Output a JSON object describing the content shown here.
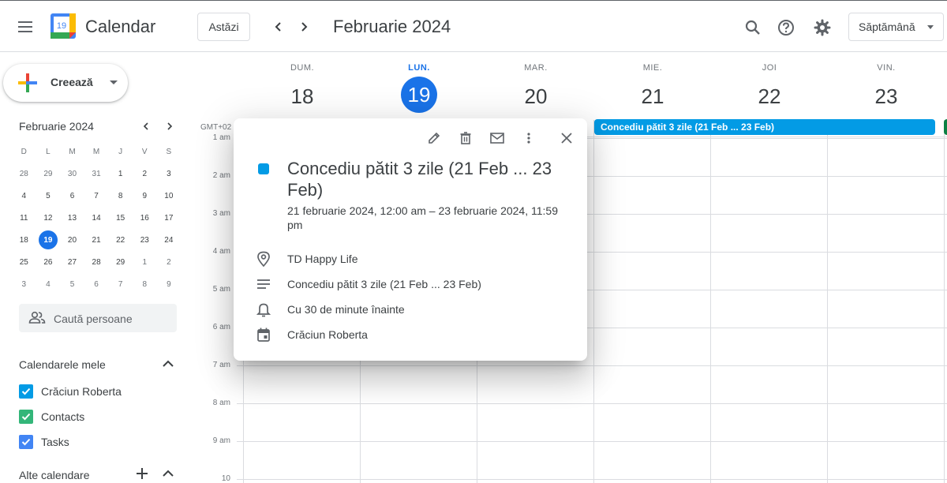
{
  "app": {
    "name": "Calendar",
    "logo_day": "19"
  },
  "header": {
    "today_label": "Astăzi",
    "period": "Februarie 2024",
    "view": "Săptămână"
  },
  "sidebar": {
    "create_label": "Creează",
    "mini_calendar": {
      "title": "Februarie 2024",
      "weekdays": [
        "D",
        "L",
        "M",
        "M",
        "J",
        "V",
        "S"
      ],
      "weeks": [
        [
          "28",
          "29",
          "30",
          "31",
          "1",
          "2",
          "3"
        ],
        [
          "4",
          "5",
          "6",
          "7",
          "8",
          "9",
          "10"
        ],
        [
          "11",
          "12",
          "13",
          "14",
          "15",
          "16",
          "17"
        ],
        [
          "18",
          "19",
          "20",
          "21",
          "22",
          "23",
          "24"
        ],
        [
          "25",
          "26",
          "27",
          "28",
          "29",
          "1",
          "2"
        ],
        [
          "3",
          "4",
          "5",
          "6",
          "7",
          "8",
          "9"
        ]
      ],
      "selected": "19"
    },
    "search_people_placeholder": "Caută persoane",
    "my_calendars_title": "Calendarele mele",
    "my_calendars": [
      {
        "name": "Crăciun Roberta",
        "color": "#039be5"
      },
      {
        "name": "Contacts",
        "color": "#33b679"
      },
      {
        "name": "Tasks",
        "color": "#4285f4"
      }
    ],
    "other_calendars_title": "Alte calendare"
  },
  "week": {
    "timezone": "GMT+02",
    "days": [
      {
        "name": "DUM.",
        "num": "18"
      },
      {
        "name": "LUN.",
        "num": "19",
        "today": true
      },
      {
        "name": "MAR.",
        "num": "20"
      },
      {
        "name": "MIE.",
        "num": "21"
      },
      {
        "name": "JOI",
        "num": "22"
      },
      {
        "name": "VIN.",
        "num": "23"
      }
    ],
    "hours": [
      "1 am",
      "2 am",
      "3 am",
      "4 am",
      "5 am",
      "6 am",
      "7 am",
      "8 am",
      "9 am",
      "10 am"
    ],
    "all_day_event": {
      "title": "Concediu pătit 3 zile (21 Feb ... 23 Feb)",
      "color": "#039be5"
    }
  },
  "popup": {
    "title": "Concediu pătit 3 zile (21 Feb ... 23 Feb)",
    "date_range": "21 februarie 2024, 12:00 am – 23 februarie 2024, 11:59 pm",
    "location": "TD Happy Life",
    "description": "Concediu pătit 3 zile (21 Feb ... 23 Feb)",
    "reminder": "Cu 30 de minute înainte",
    "calendar": "Crăciun Roberta",
    "color": "#039be5"
  }
}
